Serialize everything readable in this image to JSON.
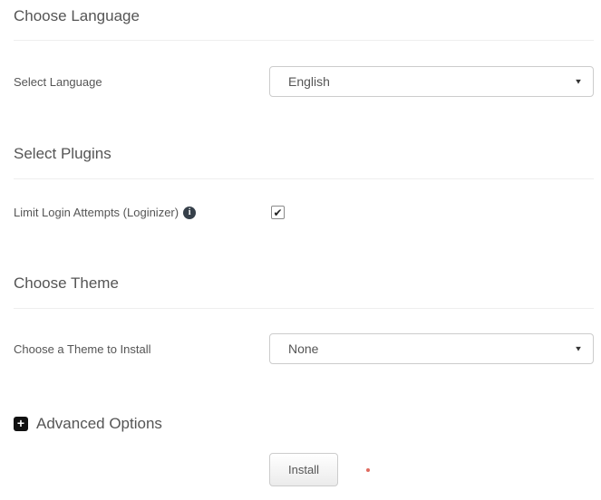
{
  "sections": {
    "language": {
      "title": "Choose Language"
    },
    "plugins": {
      "title": "Select Plugins"
    },
    "theme": {
      "title": "Choose Theme"
    }
  },
  "fields": {
    "select_language": {
      "label": "Select Language",
      "value": "English"
    },
    "loginizer": {
      "label": "Limit Login Attempts (Loginizer)",
      "checked": true,
      "checked_attr": "checked"
    },
    "choose_theme": {
      "label": "Choose a Theme to Install",
      "value": "None"
    }
  },
  "advanced": {
    "label": "Advanced Options"
  },
  "install": {
    "button_label": "Install"
  },
  "icons": {
    "info": "i",
    "plus": "+",
    "check": "✔",
    "dropdown_arrow": "▼"
  },
  "colors": {
    "heading_text": "#555555",
    "label_text": "#555555",
    "select_border": "#cccccc",
    "divider": "#eeeeee",
    "info_icon_bg": "#36404a",
    "plus_icon_bg": "#111111",
    "button_bg_top": "#ffffff",
    "button_bg_bottom": "#ebebeb",
    "red_dot": "#e06a5f"
  }
}
